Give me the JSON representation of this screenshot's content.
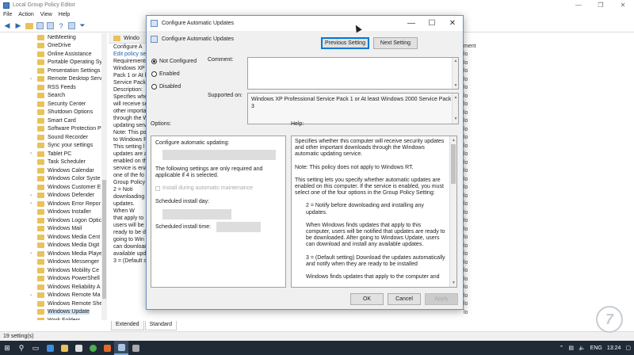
{
  "main_window": {
    "title": "Local Group Policy Editor",
    "controls": [
      "—",
      "❐",
      "✕"
    ]
  },
  "menu": [
    "File",
    "Action",
    "View",
    "Help"
  ],
  "tree_items": [
    {
      "label": "NetMeeting",
      "expandable": false
    },
    {
      "label": "OneDrive",
      "expandable": false
    },
    {
      "label": "Online Assistance",
      "expandable": false
    },
    {
      "label": "Portable Operating Sy",
      "expandable": false
    },
    {
      "label": "Presentation Settings",
      "expandable": false
    },
    {
      "label": "Remote Desktop Serv",
      "expandable": true
    },
    {
      "label": "RSS Feeds",
      "expandable": false
    },
    {
      "label": "Search",
      "expandable": false
    },
    {
      "label": "Security Center",
      "expandable": false
    },
    {
      "label": "Shutdown Options",
      "expandable": false
    },
    {
      "label": "Smart Card",
      "expandable": false
    },
    {
      "label": "Software Protection P",
      "expandable": false
    },
    {
      "label": "Sound Recorder",
      "expandable": false
    },
    {
      "label": "Sync your settings",
      "expandable": false
    },
    {
      "label": "Tablet PC",
      "expandable": true
    },
    {
      "label": "Task Scheduler",
      "expandable": false
    },
    {
      "label": "Windows Calendar",
      "expandable": false
    },
    {
      "label": "Windows Color Syste",
      "expandable": false
    },
    {
      "label": "Windows Customer E",
      "expandable": false
    },
    {
      "label": "Windows Defender",
      "expandable": true
    },
    {
      "label": "Windows Error Repor",
      "expandable": true
    },
    {
      "label": "Windows Installer",
      "expandable": false
    },
    {
      "label": "Windows Logon Optic",
      "expandable": false
    },
    {
      "label": "Windows Mail",
      "expandable": false
    },
    {
      "label": "Windows Media Cent",
      "expandable": false
    },
    {
      "label": "Windows Media Digit",
      "expandable": false
    },
    {
      "label": "Windows Media Playe",
      "expandable": true
    },
    {
      "label": "Windows Messenger",
      "expandable": false
    },
    {
      "label": "Windows Mobility Ce",
      "expandable": false
    },
    {
      "label": "Windows PowerShell",
      "expandable": false
    },
    {
      "label": "Windows Reliability A",
      "expandable": false
    },
    {
      "label": "Windows Remote Ma",
      "expandable": true
    },
    {
      "label": "Windows Remote She",
      "expandable": false
    },
    {
      "label": "Windows Update",
      "expandable": false,
      "selected": true
    },
    {
      "label": "Work Folders",
      "expandable": false
    }
  ],
  "middle": {
    "header": "Windo",
    "lines": [
      "Configure A",
      "",
      "Edit policy se",
      "",
      "Requirements",
      "Windows XP",
      "Pack 1 or At l",
      "Service Pack",
      "",
      "Description:",
      "Specifies whe",
      "will receive se",
      "other importa",
      "through the W",
      "updating serv",
      "",
      "Note: This po",
      "to Windows R",
      "",
      "This setting l",
      "updates are a",
      "enabled on th",
      "service is ena",
      "one of the fo",
      "Group Policy",
      "",
      "2 = Noti",
      "downloading",
      "updates.",
      "",
      "When W",
      "that apply to",
      "users will be notifie",
      "ready to be d",
      "going to Win",
      "can download",
      "available upd",
      "",
      "3 = (Default setting)"
    ]
  },
  "right_column": {
    "header": "ment",
    "cells": [
      "lo",
      "lo",
      "lo",
      "lo",
      "lo",
      "lo",
      "lo",
      "lo",
      "lo",
      "lo",
      "lo",
      "lo",
      "lo",
      "lo",
      "lo",
      "lo",
      "lo",
      "lo",
      "lo",
      "lo",
      "lo",
      "lo",
      "lo",
      "lo",
      "lo",
      "lo",
      "lo",
      "lo",
      "lo",
      "lo",
      "lo",
      "lo"
    ]
  },
  "tabs": [
    "Extended",
    "Standard"
  ],
  "status": "19 setting(s)",
  "dialog": {
    "title": "Configure Automatic Updates",
    "subtitle": "Configure Automatic Updates",
    "prev_button": "Previous Setting",
    "next_button": "Next Setting",
    "radios": [
      {
        "label": "Not Configured",
        "checked": true
      },
      {
        "label": "Enabled",
        "checked": false
      },
      {
        "label": "Disabled",
        "checked": false
      }
    ],
    "comment_label": "Comment:",
    "supported_label": "Supported on:",
    "supported_value": "Windows XP Professional Service Pack 1 or At least Windows 2000 Service Pack 3",
    "options_label": "Options:",
    "help_label": "Help:",
    "options": {
      "configure_label": "Configure automatic updating:",
      "note": "The following settings are only required and applicable if 4 is selected.",
      "install_maintenance": "Install during automatic maintenance",
      "scheduled_day": "Scheduled install day:",
      "scheduled_time": "Scheduled install time:"
    },
    "help_paragraphs": [
      "Specifies whether this computer will receive security updates and other important downloads through the Windows automatic updating service.",
      "Note: This policy does not apply to Windows RT.",
      "This setting lets you specify whether automatic updates are enabled on this computer. If the service is enabled, you must select one of the four options in the Group Policy Setting:",
      "2 = Notify before downloading and installing any updates.",
      "When Windows finds updates that apply to this computer, users will be notified that updates are ready to be downloaded. After going to Windows Update, users can download and install any available updates.",
      "3 = (Default setting) Download the updates automatically and notify when they are ready to be installed",
      "Windows finds updates that apply to the computer and"
    ],
    "ok": "OK",
    "cancel": "Cancel",
    "apply": "Apply"
  },
  "taskbar": {
    "tray": [
      "ENG",
      "13:24"
    ]
  },
  "colors": {
    "accent": "#0078d7",
    "taskbar": "#1f2a36",
    "folder": "#e8c25a",
    "selected": "#cce4f7"
  }
}
